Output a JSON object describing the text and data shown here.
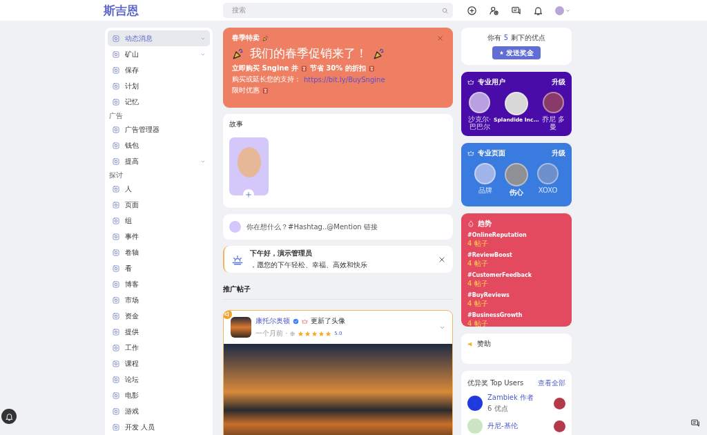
{
  "header": {
    "logo": "斯吉恩",
    "search_placeholder": "搜索"
  },
  "sidebar": {
    "items": [
      {
        "kind": "item",
        "label": "动态消息",
        "selected": true,
        "expandable": true
      },
      {
        "kind": "item",
        "label": "矿山",
        "selected": false,
        "expandable": true
      },
      {
        "kind": "item",
        "label": "保存",
        "selected": false,
        "expandable": false
      },
      {
        "kind": "item",
        "label": "计划",
        "selected": false,
        "expandable": false
      },
      {
        "kind": "item",
        "label": "记忆",
        "selected": false,
        "expandable": false
      },
      {
        "kind": "section",
        "label": "广告"
      },
      {
        "kind": "item",
        "label": "广告管理器",
        "selected": false,
        "expandable": false
      },
      {
        "kind": "item",
        "label": "钱包",
        "selected": false,
        "expandable": false
      },
      {
        "kind": "item",
        "label": "提高",
        "selected": false,
        "expandable": true
      },
      {
        "kind": "section",
        "label": "探讨"
      },
      {
        "kind": "item",
        "label": "人",
        "selected": false,
        "expandable": false
      },
      {
        "kind": "item",
        "label": "页面",
        "selected": false,
        "expandable": false
      },
      {
        "kind": "item",
        "label": "组",
        "selected": false,
        "expandable": false
      },
      {
        "kind": "item",
        "label": "事件",
        "selected": false,
        "expandable": false
      },
      {
        "kind": "item",
        "label": "卷轴",
        "selected": false,
        "expandable": false
      },
      {
        "kind": "item",
        "label": "看",
        "selected": false,
        "expandable": false
      },
      {
        "kind": "item",
        "label": "博客",
        "selected": false,
        "expandable": false
      },
      {
        "kind": "item",
        "label": "市场",
        "selected": false,
        "expandable": false
      },
      {
        "kind": "item",
        "label": "资金",
        "selected": false,
        "expandable": false
      },
      {
        "kind": "item",
        "label": "提供",
        "selected": false,
        "expandable": false
      },
      {
        "kind": "item",
        "label": "工作",
        "selected": false,
        "expandable": false
      },
      {
        "kind": "item",
        "label": "课程",
        "selected": false,
        "expandable": false
      },
      {
        "kind": "item",
        "label": "论坛",
        "selected": false,
        "expandable": false
      },
      {
        "kind": "item",
        "label": "电影",
        "selected": false,
        "expandable": false
      },
      {
        "kind": "item",
        "label": "游戏",
        "selected": false,
        "expandable": false
      },
      {
        "kind": "item",
        "label": "开发 人员",
        "selected": false,
        "expandable": false
      }
    ]
  },
  "promo": {
    "tag": "春季特卖",
    "headline": "我们的春季促销来了！",
    "offer_parts": [
      "立即购买 Sngine 并",
      "节省 30% 的折扣"
    ],
    "support_text": "购买或延长您的支持：",
    "link": "https://bit.ly/BuySngine",
    "limited": "限时优惠"
  },
  "stories": {
    "title": "故事"
  },
  "composer": {
    "placeholder": "你在想什么？#Hashtag..@Mention 链接"
  },
  "greeting": {
    "title": "下午好，演示管理员",
    "message": "，愿您的下午轻松、幸福、高效和快乐"
  },
  "promoted": {
    "title": "推广帖子",
    "post": {
      "author": "康托尔奥顿",
      "action": "更新了头像",
      "time": "一个月前 ·",
      "stars": 5,
      "rating": "5.0"
    }
  },
  "points": {
    "prefix": "你有",
    "count": "5",
    "suffix": "剩下的优点",
    "button": "发送奖金"
  },
  "pro_users": {
    "title": "专业用户",
    "upgrade": "升级",
    "items": [
      {
        "name": "沙克尔·巴巴尔",
        "bold": false
      },
      {
        "name": "Splandide Inc...",
        "bold": true
      },
      {
        "name": "乔尼 多曼",
        "bold": false
      }
    ]
  },
  "pro_pages": {
    "title": "专业页面",
    "upgrade": "升级",
    "items": [
      {
        "name": "品牌",
        "bold": false
      },
      {
        "name": "伤心",
        "bold": true
      },
      {
        "name": "XOXO",
        "bold": false
      }
    ]
  },
  "trends": {
    "title": "趋势",
    "items": [
      {
        "tag": "#OnlineReputation",
        "count": "4 帖子"
      },
      {
        "tag": "#ReviewBoost",
        "count": "4 帖子"
      },
      {
        "tag": "#CustomerFeedback",
        "count": "4 帖子"
      },
      {
        "tag": "#BuyReviews",
        "count": "4 帖子"
      },
      {
        "tag": "#BusinessGrowth",
        "count": "4 帖子"
      }
    ]
  },
  "sponsored": {
    "title": "赞助"
  },
  "top_users": {
    "title": "优异奖 Top Users",
    "see_all": "查看全部",
    "items": [
      {
        "name": "Zambiek 作者",
        "points": "6 优点"
      },
      {
        "name": "丹尼-基伦"
      }
    ]
  }
}
